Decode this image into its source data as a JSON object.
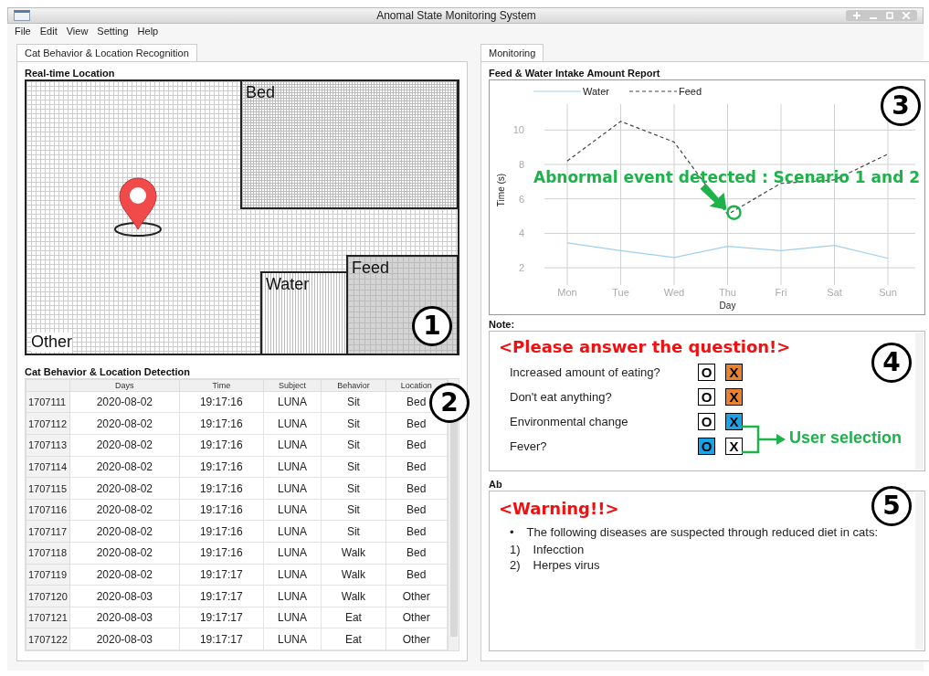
{
  "window": {
    "title": "Anomal State Monitoring System"
  },
  "menu": [
    "File",
    "Edit",
    "View",
    "Setting",
    "Help"
  ],
  "left_tabs": [
    {
      "label": "Cat Behavior & Location Recognition",
      "selected": true
    }
  ],
  "location": {
    "title": "Real-time Location",
    "marker": "1",
    "zones": [
      {
        "kind": "bed",
        "label": "Bed"
      },
      {
        "kind": "water",
        "label": "Water"
      },
      {
        "kind": "feed",
        "label": "Feed"
      },
      {
        "kind": "other",
        "label": "Other"
      }
    ]
  },
  "detection": {
    "title": "Cat Behavior & Location Detection",
    "marker": "2",
    "columns": [
      "Days",
      "Time",
      "Subject",
      "Behavior",
      "Location"
    ],
    "rows": [
      {
        "id": "1707111",
        "cells": [
          "2020-08-02",
          "19:17:16",
          "LUNA",
          "Sit",
          "Bed"
        ]
      },
      {
        "id": "1707112",
        "cells": [
          "2020-08-02",
          "19:17:16",
          "LUNA",
          "Sit",
          "Bed"
        ]
      },
      {
        "id": "1707113",
        "cells": [
          "2020-08-02",
          "19:17:16",
          "LUNA",
          "Sit",
          "Bed"
        ]
      },
      {
        "id": "1707114",
        "cells": [
          "2020-08-02",
          "19:17:16",
          "LUNA",
          "Sit",
          "Bed"
        ]
      },
      {
        "id": "1707115",
        "cells": [
          "2020-08-02",
          "19:17:16",
          "LUNA",
          "Sit",
          "Bed"
        ]
      },
      {
        "id": "1707116",
        "cells": [
          "2020-08-02",
          "19:17:16",
          "LUNA",
          "Sit",
          "Bed"
        ]
      },
      {
        "id": "1707117",
        "cells": [
          "2020-08-02",
          "19:17:16",
          "LUNA",
          "Sit",
          "Bed"
        ]
      },
      {
        "id": "1707118",
        "cells": [
          "2020-08-02",
          "19:17:16",
          "LUNA",
          "Walk",
          "Bed"
        ]
      },
      {
        "id": "1707119",
        "cells": [
          "2020-08-02",
          "19:17:17",
          "LUNA",
          "Walk",
          "Bed"
        ]
      },
      {
        "id": "1707120",
        "cells": [
          "2020-08-03",
          "19:17:17",
          "LUNA",
          "Walk",
          "Other"
        ]
      },
      {
        "id": "1707121",
        "cells": [
          "2020-08-03",
          "19:17:17",
          "LUNA",
          "Eat",
          "Other"
        ]
      },
      {
        "id": "1707122",
        "cells": [
          "2020-08-03",
          "19:17:17",
          "LUNA",
          "Eat",
          "Other"
        ]
      }
    ]
  },
  "right_tabs": [
    {
      "label": "Monitoring",
      "selected": true
    }
  ],
  "report": {
    "title": "Feed & Water Intake Amount Report",
    "marker": "3",
    "chart_data": {
      "type": "line",
      "xlabel": "Day",
      "ylabel": "Time (s)",
      "categories": [
        "Mon",
        "Tue",
        "Wed",
        "Thu",
        "Fri",
        "Sat",
        "Sun"
      ],
      "series": [
        {
          "name": "Water",
          "color": "#9fd0f0",
          "line_style": "solid",
          "values": [
            3.45,
            3.0,
            2.6,
            3.25,
            3.0,
            3.3,
            2.55
          ]
        },
        {
          "name": "Feed",
          "color": "#444444",
          "line_style": "dashed",
          "values": [
            8.2,
            10.5,
            9.3,
            5.1,
            6.9,
            7.1,
            8.6
          ]
        }
      ],
      "ylim": [
        1,
        11.5
      ],
      "yticks": [
        {
          "value": 2,
          "label": "2"
        },
        {
          "value": 4,
          "label": "4"
        },
        {
          "value": 6,
          "label": "6"
        },
        {
          "value": 8,
          "label": "8"
        },
        {
          "value": 10,
          "label": "10"
        }
      ],
      "grid": true,
      "legend": "top",
      "annotations": [
        {
          "text": "Abnormal event detected : Scenario 1 and 2",
          "x": "Thu",
          "y": 5.1
        }
      ]
    }
  },
  "note": {
    "label": "Note:",
    "marker": "4",
    "heading": "<Please answer the question!>",
    "callout": "User selection",
    "questions": [
      {
        "text": "Increased amount of eating?",
        "options": [
          {
            "label": "O",
            "selected": false
          },
          {
            "label": "X",
            "selected": true,
            "color": "#e8822e"
          }
        ]
      },
      {
        "text": "Don't eat anything?",
        "options": [
          {
            "label": "O",
            "selected": false
          },
          {
            "label": "X",
            "selected": true,
            "color": "#e8822e"
          }
        ]
      },
      {
        "text": "Environmental change",
        "options": [
          {
            "label": "O",
            "selected": false
          },
          {
            "label": "X",
            "selected": true,
            "color": "#1aa3e8"
          }
        ]
      },
      {
        "text": "Fever?",
        "options": [
          {
            "label": "O",
            "selected": true,
            "color": "#1aa3e8"
          },
          {
            "label": "X",
            "selected": false
          }
        ]
      }
    ]
  },
  "alert": {
    "label": "Ab",
    "marker": "5",
    "heading": "<Warning!!>",
    "bullet_mark": "•",
    "bullet": "The following diseases are suspected through reduced diet in cats:",
    "items": [
      {
        "num": "1)",
        "text": "Infecction"
      },
      {
        "num": "2)",
        "text": "Herpes virus"
      }
    ]
  }
}
